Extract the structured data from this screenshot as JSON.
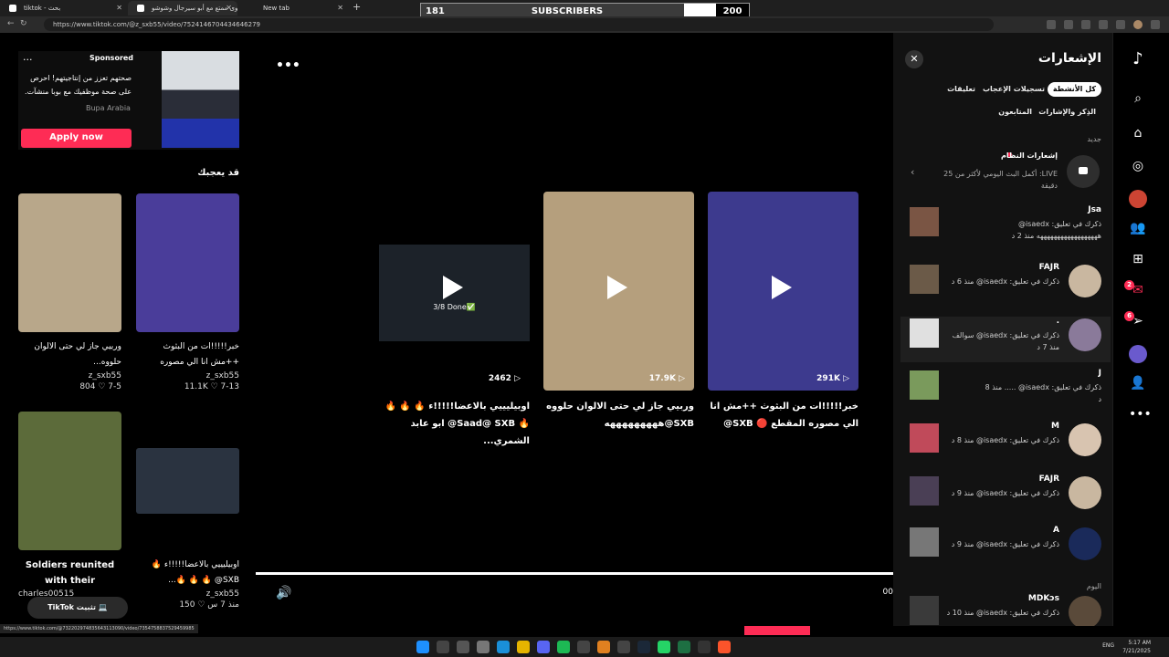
{
  "browser": {
    "tabs": [
      {
        "title": "tiktok - بحث"
      },
      {
        "title": "محتوى ممتع مع أبو سيرجال وشوشو"
      },
      {
        "title": "New tab"
      }
    ],
    "url": "https://www.tiktok.com/@z_sxb55/video/7524146704434646279",
    "status_url": "https://www.tiktok.com/@732202974835643113090/video/7354758837529459985"
  },
  "subscribers": {
    "current": "181",
    "label": "SUBSCRIBERS",
    "goal": "200",
    "fill_fraction": 0.905
  },
  "ad": {
    "more": "...",
    "sponsored": "Sponsored",
    "text": "صحتهم تعزز من إنتاجيتهم! احرص على صحة موظفيك مع بوبا منشآت.",
    "brand": "Bupa Arabia",
    "apply": "Apply now"
  },
  "may_like": {
    "title": "قد يعجبك",
    "cards": [
      {
        "caption": "خبر!!!!!ات من البثوث ++مش انا الي مصوره المقطع 🔴",
        "author": "z_sxb55",
        "stats": "11.1K ♡ 7-13",
        "thumb": "#4a3d9a"
      },
      {
        "caption": "وربيي جاز لي حتى الالوان حلووه...",
        "author": "z_sxb55",
        "stats": "804 ♡ 7-5",
        "thumb": "#b8a78a"
      },
      {
        "caption": "اوبيليييي بالاعضا!!!!!ء 🔥 SXB@ 🔥 🔥 🔥...",
        "author": "z_sxb55",
        "stats": "150 ♡ منذ 7 س",
        "thumb": "#2a3340"
      },
      {
        "caption": "Soldiers reunited with their families...",
        "author": "charles00515",
        "stats": "",
        "thumb": "#5c6b3a"
      }
    ]
  },
  "center": {
    "more": "•••",
    "videos": [
      {
        "views": "291K",
        "caption": "خبر!!!!!ات من البثوث ++مش انا الي مصوره المقطع 🔴 SXB@",
        "thumb": "#3d3a8e"
      },
      {
        "views": "17.9K",
        "caption": "وربيي جاز لي حتى الالوان حلووه SXB@هههههههههه",
        "thumb": "#b59f7d"
      },
      {
        "views": "2462",
        "caption": "اوبيليييي بالاعضا!!!!!ء 🔥 🔥 🔥 🔥 Saad@ SXB@ ابو عابد الشمري...",
        "thumb": "#1c2229",
        "overlay": "3/8 Done✅"
      }
    ],
    "volume_icon": "🔊",
    "time": "00"
  },
  "notifications": {
    "title": "الإشعارات",
    "close": "✕",
    "pills": [
      {
        "label": "كل الأنشطة",
        "active": true
      },
      {
        "label": "تسجيلات الإعجاب",
        "active": false
      },
      {
        "label": "تعليقات",
        "active": false
      },
      {
        "label": "الذِكر والإشارات",
        "active": false
      },
      {
        "label": "المتابعون",
        "active": false
      }
    ],
    "new_label": "جديد",
    "system": {
      "title": "إشعارات النظام",
      "text": "LIVE: أكمل البث اليومي لأكثر من 25 دقيقة"
    },
    "items": [
      {
        "name": "Jsa",
        "desc": "ذكرك في تعليق: isaedx@ ههههههههههههههههههه منذ 2 د",
        "thumb": "#7a5544",
        "avatar": ""
      },
      {
        "name": "FAJR",
        "desc": "ذكرك في تعليق: isaedx@ منذ 6 د",
        "thumb": "#6b5a48",
        "avatar": "#c9b7a0"
      },
      {
        "name": ".",
        "desc": "ذكرك في تعليق: isaedx@ سوالف منذ 7 د",
        "thumb": "#e0e0e0",
        "avatar": "#8a7a9a",
        "highlight": true
      },
      {
        "name": "J",
        "desc": "ذكرك في تعليق: isaedx@ ..... منذ 8 د",
        "thumb": "#7a9a5c",
        "avatar": ""
      },
      {
        "name": "M",
        "desc": "ذكرك في تعليق: isaedx@ منذ 8 د",
        "thumb": "#c04a5a",
        "avatar": "#d8c4b0"
      },
      {
        "name": "FAJR",
        "desc": "ذكرك في تعليق: isaedx@ منذ 9 د",
        "thumb": "#4a3f55",
        "avatar": "#c9b7a0"
      },
      {
        "name": "A",
        "desc": "ذكرك في تعليق: isaedx@ منذ 9 د",
        "thumb": "#777",
        "avatar": "#1a2a5a"
      },
      {
        "name": "MDKↄs",
        "desc": "ذكرك في تعليق: isaedx@ منذ 10 د",
        "thumb": "#3a3a3a",
        "avatar": "#5a4a3a"
      }
    ],
    "today_label": "اليوم"
  },
  "rnav": {
    "items": [
      "tiktok-logo",
      "search",
      "home",
      "explore",
      "profile-following",
      "friends",
      "upload",
      "inbox",
      "messages",
      "live",
      "profile",
      "more"
    ],
    "inbox_badge": "2",
    "messages_badge": "6"
  },
  "taskbar": {
    "lang": "ENG",
    "time": "5:17 AM",
    "date": "7/21/2025"
  },
  "colors": {
    "accent": "#fe2c55",
    "bg": "#000000",
    "panel": "#121212"
  }
}
